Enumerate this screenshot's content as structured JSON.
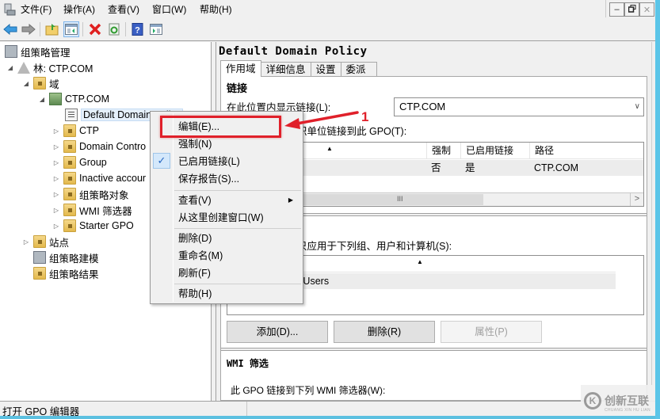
{
  "menubar": {
    "items": [
      "文件(F)",
      "操作(A)",
      "查看(V)",
      "窗口(W)",
      "帮助(H)"
    ]
  },
  "window_controls": {
    "minimize": "‒",
    "restore": "🗗",
    "close": "✕"
  },
  "toolbar": {
    "buttons": [
      {
        "name": "back",
        "icon": "arrow-left-icon"
      },
      {
        "name": "forward",
        "icon": "arrow-right-icon"
      },
      {
        "name": "up-folder",
        "icon": "folder-up-icon"
      },
      {
        "name": "show-hide-console-tree",
        "icon": "console-tree-icon"
      },
      {
        "name": "delete",
        "icon": "delete-x-icon"
      },
      {
        "name": "refresh",
        "icon": "refresh-icon"
      },
      {
        "name": "help",
        "icon": "help-icon"
      },
      {
        "name": "show-hide-action-pane",
        "icon": "action-pane-icon"
      }
    ],
    "help_glyph": "?"
  },
  "tree": {
    "root": "组策略管理",
    "forest": "林: CTP.COM",
    "domains": "域",
    "domain": "CTP.COM",
    "items": [
      {
        "label": "Default Domain Policy",
        "type": "gpo-link",
        "selected": true
      },
      {
        "label": "CTP",
        "type": "ou"
      },
      {
        "label": "Domain Contro",
        "type": "ou"
      },
      {
        "label": "Group",
        "type": "ou"
      },
      {
        "label": "Inactive accour",
        "type": "ou"
      },
      {
        "label": "组策略对象",
        "type": "container"
      },
      {
        "label": "WMI 筛选器",
        "type": "container"
      },
      {
        "label": "Starter GPO",
        "type": "container"
      }
    ],
    "sites": "站点",
    "modeling": "组策略建模",
    "results": "组策略结果"
  },
  "context_menu": {
    "items": [
      {
        "label": "编辑(E)...",
        "highlighted": true
      },
      {
        "label": "强制(N)"
      },
      {
        "label": "已启用链接(L)",
        "checked": true
      },
      {
        "label": "保存报告(S)..."
      },
      {
        "label": "查看(V)",
        "submenu": true
      },
      {
        "label": "从这里创建窗口(W)"
      },
      {
        "label": "删除(D)"
      },
      {
        "label": "重命名(M)"
      },
      {
        "label": "刷新(F)"
      },
      {
        "label": "帮助(H)"
      }
    ],
    "check_glyph": "✓",
    "submenu_glyph": "▶"
  },
  "annotation": {
    "step_number": "1",
    "color": "#e0202a"
  },
  "details": {
    "title": "Default Domain Policy",
    "tabs": [
      "作用域",
      "详细信息",
      "设置",
      "委派"
    ],
    "active_tab": "作用域",
    "links_section": {
      "heading": "链接",
      "location_label": "在此位置内显示链接(L):",
      "location_value": "CTP.COM",
      "linked_label_partial": "织单位链接到此 GPO(T):",
      "columns": [
        "",
        "强制",
        "已启用链接",
        "路径"
      ],
      "rows": [
        {
          "location": "",
          "enforced": "否",
          "enabled": "是",
          "path": "CTP.COM"
        }
      ],
      "scroll_grip": "III",
      "scroll_right": ">"
    },
    "security_section": {
      "label_partial": "只应用于下列组、用户和计算机(S):",
      "rows": [
        "d Users"
      ],
      "buttons": {
        "add": "添加(D)...",
        "remove": "删除(R)",
        "properties": "属性(P)"
      }
    },
    "wmi_section": {
      "heading": "WMI 筛选",
      "label": "此 GPO 链接到下列 WMI 筛选器(W):"
    }
  },
  "statusbar": {
    "text": "打开 GPO 编辑器"
  },
  "watermark": {
    "text": "创新互联",
    "sub": "CHUANG XIN HU LIAN",
    "logo": "K"
  },
  "sort_glyph": "▲",
  "combo_glyph": "∨",
  "expand_glyphs": {
    "expanded": "◢",
    "collapsed": "▷"
  }
}
